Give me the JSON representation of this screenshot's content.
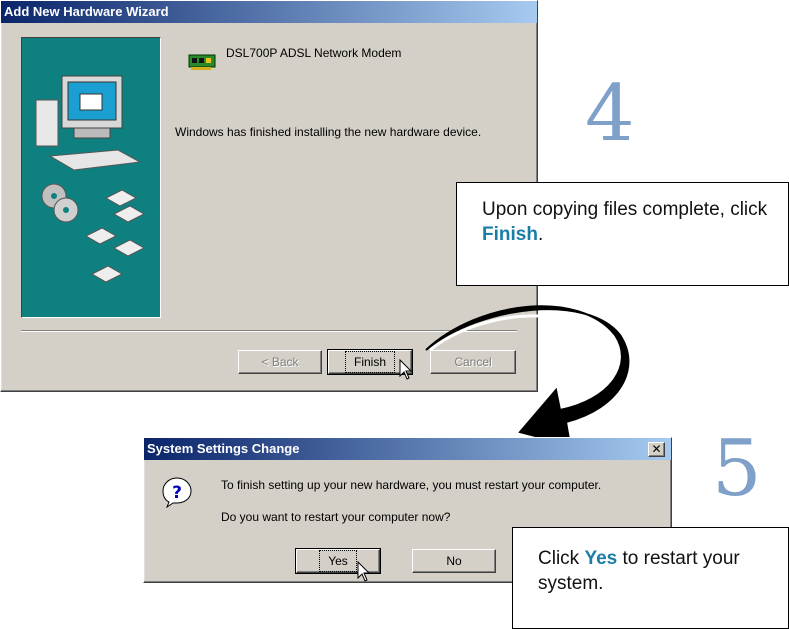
{
  "wizard": {
    "title": "Add New Hardware Wizard",
    "device_name": "DSL700P ADSL Network Modem",
    "message": "Windows has finished installing the new hardware device.",
    "buttons": {
      "back": "< Back",
      "finish": "Finish",
      "cancel": "Cancel"
    }
  },
  "step4": {
    "number": "4",
    "callout_pre": "Upon copying files complete, click ",
    "callout_bold": "Finish",
    "callout_post": "."
  },
  "dialog": {
    "title": "System Settings Change",
    "line1": "To finish setting up your new hardware, you must restart your computer.",
    "line2": "Do you want to restart your computer now?",
    "buttons": {
      "yes": "Yes",
      "no": "No"
    }
  },
  "step5": {
    "number": "5",
    "callout_pre": "Click ",
    "callout_bold": "Yes",
    "callout_post": " to restart your system."
  },
  "colors": {
    "accent": "#1a7fa8",
    "titlebar": "#0a246a",
    "panel": "#0f8080",
    "step_number": "#7fa0c8"
  },
  "icons": [
    "network-card-icon",
    "computer-illustration",
    "question-icon",
    "close-icon",
    "mouse-cursor-icon",
    "curved-arrow"
  ]
}
